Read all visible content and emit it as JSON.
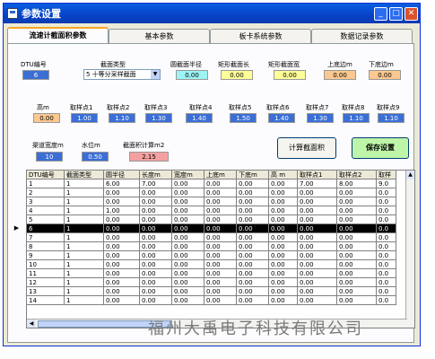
{
  "window": {
    "title": "参数设置"
  },
  "tabs": [
    "流速计截面积参数",
    "基本参数",
    "板卡系统参数",
    "数据记录参数"
  ],
  "form": {
    "dtu": {
      "label": "DTU编号",
      "value": "6"
    },
    "section_type": {
      "label": "截面类型",
      "value": "5 十等分采样截面"
    },
    "radius": {
      "label": "圆截面半径",
      "value": "0.00"
    },
    "rect_len": {
      "label": "矩形截面长",
      "value": "0.00"
    },
    "rect_wid": {
      "label": "矩形截面宽",
      "value": "0.00"
    },
    "top_edge": {
      "label": "上底边m",
      "value": "0.00"
    },
    "bottom_edge": {
      "label": "下底边m",
      "value": "0.00"
    },
    "height": {
      "label": "高m",
      "value": "0.00"
    },
    "points": [
      {
        "label": "取样点1",
        "value": "1.00"
      },
      {
        "label": "取样点2",
        "value": "1.10"
      },
      {
        "label": "取样点3",
        "value": "1.30"
      },
      {
        "label": "取样点4",
        "value": "1.40"
      },
      {
        "label": "取样点5",
        "value": "1.50"
      },
      {
        "label": "取样点6",
        "value": "1.40"
      },
      {
        "label": "取样点7",
        "value": "1.30"
      },
      {
        "label": "取样点8",
        "value": "1.10"
      },
      {
        "label": "取样点9",
        "value": "1.10"
      }
    ],
    "channel_width": {
      "label": "渠道宽度m",
      "value": "10"
    },
    "water_level": {
      "label": "水位m",
      "value": "0.50"
    },
    "area": {
      "label": "截面积计算m2",
      "value": "2.15"
    }
  },
  "buttons": {
    "calc": "计算截面积",
    "save": "保存设置"
  },
  "table": {
    "columns": [
      "DTU编号",
      "截面类型",
      "圆半径",
      "长度m",
      "宽度m",
      "上底m",
      "下底m",
      "高 m",
      "取样点1",
      "取样点2",
      "取样"
    ],
    "rows": [
      [
        "1",
        "1",
        "6.00",
        "7.00",
        "0.00",
        "0.00",
        "0.00",
        "0.00",
        "7.00",
        "8.00",
        "9.0"
      ],
      [
        "2",
        "1",
        "0.00",
        "0.00",
        "0.00",
        "0.00",
        "0.00",
        "0.00",
        "0.00",
        "0.00",
        "0.0"
      ],
      [
        "3",
        "1",
        "0.00",
        "0.00",
        "0.00",
        "0.00",
        "0.00",
        "0.00",
        "0.00",
        "0.00",
        "0.0"
      ],
      [
        "4",
        "1",
        "1.00",
        "0.00",
        "0.00",
        "0.00",
        "0.00",
        "0.00",
        "0.00",
        "0.00",
        "0.0"
      ],
      [
        "5",
        "1",
        "0.00",
        "0.00",
        "0.00",
        "0.00",
        "0.00",
        "0.00",
        "0.00",
        "0.00",
        "0.0"
      ],
      [
        "6",
        "1",
        "0.00",
        "0.00",
        "0.00",
        "0.00",
        "0.00",
        "0.00",
        "0.00",
        "0.00",
        "0.0"
      ],
      [
        "7",
        "1",
        "0.00",
        "0.00",
        "0.00",
        "0.00",
        "0.00",
        "0.00",
        "0.00",
        "0.00",
        "0.0"
      ],
      [
        "8",
        "1",
        "0.00",
        "0.00",
        "0.00",
        "0.00",
        "0.00",
        "0.00",
        "0.00",
        "0.00",
        "0.0"
      ],
      [
        "9",
        "1",
        "0.00",
        "0.00",
        "0.00",
        "0.00",
        "0.00",
        "0.00",
        "0.00",
        "0.00",
        "0.0"
      ],
      [
        "10",
        "1",
        "0.00",
        "0.00",
        "0.00",
        "0.00",
        "0.00",
        "0.00",
        "0.00",
        "0.00",
        "0.0"
      ],
      [
        "11",
        "1",
        "0.00",
        "0.00",
        "0.00",
        "0.00",
        "0.00",
        "0.00",
        "0.00",
        "0.00",
        "0.0"
      ],
      [
        "12",
        "1",
        "0.00",
        "0.00",
        "0.00",
        "0.00",
        "0.00",
        "0.00",
        "0.00",
        "0.00",
        "0.0"
      ],
      [
        "13",
        "1",
        "0.00",
        "0.00",
        "0.00",
        "0.00",
        "0.00",
        "0.00",
        "0.00",
        "0.00",
        "0.0"
      ],
      [
        "14",
        "1",
        "0.00",
        "0.00",
        "0.00",
        "0.00",
        "0.00",
        "0.00",
        "0.00",
        "0.00",
        "0.0"
      ]
    ],
    "selected_row": 5
  },
  "watermark": "福州大禹电子科技有限公司"
}
